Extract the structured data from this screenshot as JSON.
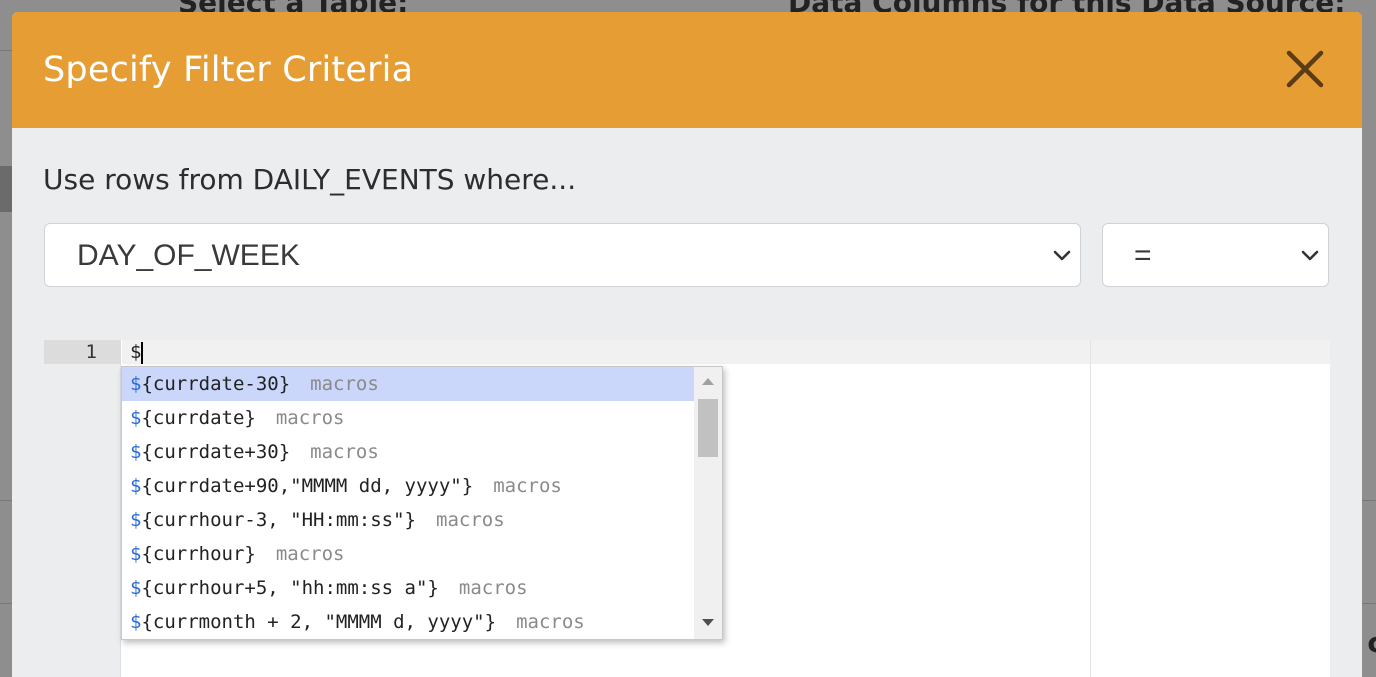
{
  "background": {
    "left_heading": "Select a Table:",
    "right_heading": "Data Columns for this Data Source:",
    "edge_text": "c"
  },
  "modal": {
    "title": "Specify Filter Criteria",
    "close_icon": "close-icon",
    "header_color": "#e69d33"
  },
  "filter": {
    "intro": "Use rows from DAILY_EVENTS where...",
    "column_select": {
      "value": "DAY_OF_WEEK"
    },
    "operator_select": {
      "value": "="
    }
  },
  "editor": {
    "line_number": "1",
    "content": "$"
  },
  "autocomplete": {
    "items": [
      {
        "prefix": "$",
        "value": "{currdate-30}",
        "meta": "macros",
        "selected": true
      },
      {
        "prefix": "$",
        "value": "{currdate}",
        "meta": "macros",
        "selected": false
      },
      {
        "prefix": "$",
        "value": "{currdate+30}",
        "meta": "macros",
        "selected": false
      },
      {
        "prefix": "$",
        "value": "{currdate+90,\"MMMM dd, yyyy\"}",
        "meta": "macros",
        "selected": false
      },
      {
        "prefix": "$",
        "value": "{currhour-3, \"HH:mm:ss\"}",
        "meta": "macros",
        "selected": false
      },
      {
        "prefix": "$",
        "value": "{currhour}",
        "meta": "macros",
        "selected": false
      },
      {
        "prefix": "$",
        "value": "{currhour+5, \"hh:mm:ss a\"}",
        "meta": "macros",
        "selected": false
      },
      {
        "prefix": "$",
        "value": "{currmonth + 2, \"MMMM d, yyyy\"}",
        "meta": "macros",
        "selected": false
      }
    ]
  }
}
